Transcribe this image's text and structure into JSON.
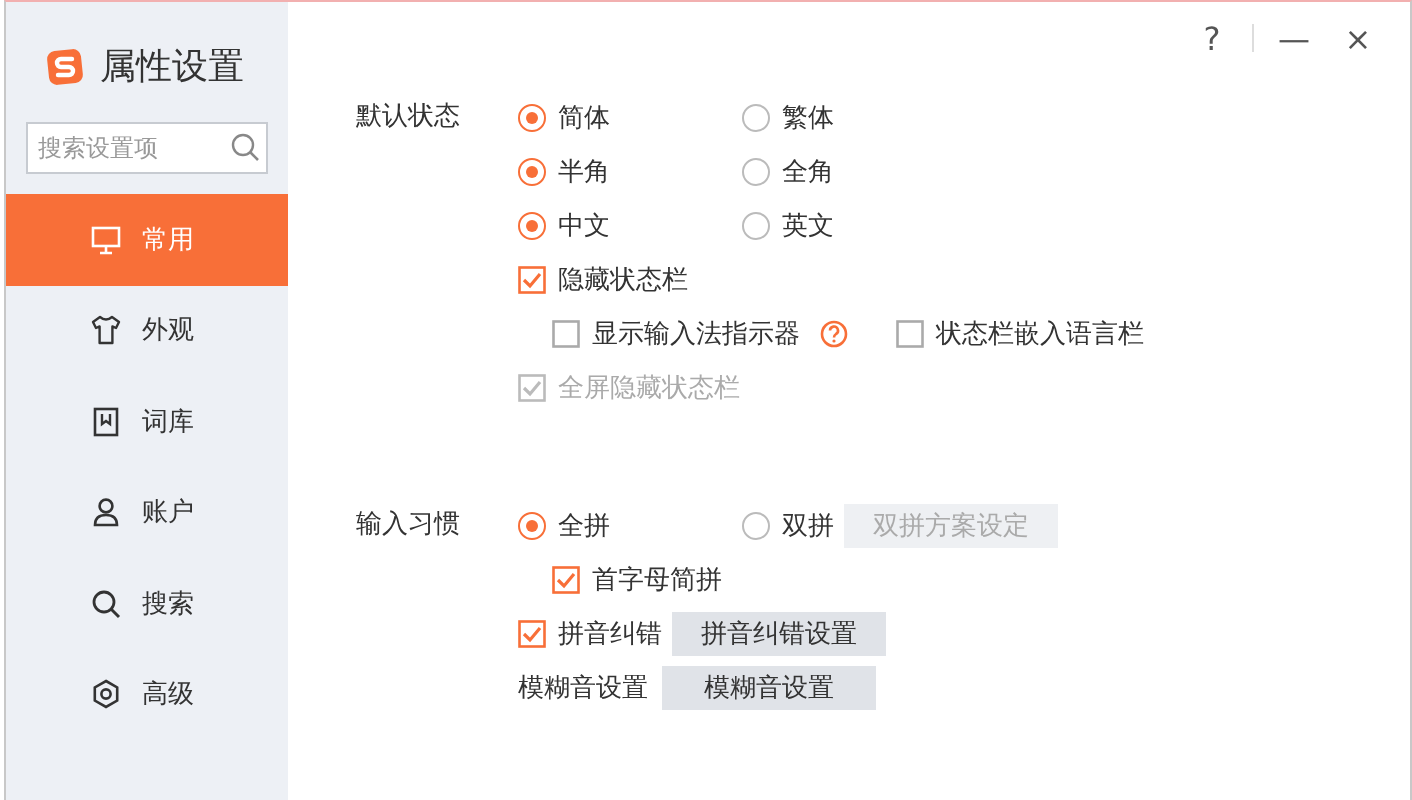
{
  "window": {
    "controls": [
      {
        "kind": "help",
        "label": "?"
      },
      {
        "kind": "minimize",
        "label": "—"
      },
      {
        "kind": "close",
        "label": "×"
      }
    ]
  },
  "sidebar": {
    "title": "属性设置",
    "search": {
      "placeholder": "搜索设置项"
    },
    "items": [
      {
        "label": "常用",
        "selected": true
      },
      {
        "label": "外观",
        "selected": false
      },
      {
        "label": "词库",
        "selected": false
      },
      {
        "label": "账户",
        "selected": false
      },
      {
        "label": "搜索",
        "selected": false
      },
      {
        "label": "高级",
        "selected": false
      }
    ]
  },
  "sections": [
    {
      "label": "默认状态",
      "rows": [
        {
          "kind": "radios",
          "options": [
            {
              "label": "简体",
              "selected": true
            },
            {
              "label": "繁体",
              "selected": false
            }
          ]
        },
        {
          "kind": "radios",
          "options": [
            {
              "label": "半角",
              "selected": true
            },
            {
              "label": "全角",
              "selected": false
            }
          ]
        },
        {
          "kind": "radios",
          "options": [
            {
              "label": "中文",
              "selected": true
            },
            {
              "label": "英文",
              "selected": false
            }
          ]
        },
        {
          "kind": "checkbox",
          "label": "隐藏状态栏",
          "checked": true,
          "disabled": false,
          "children": [
            {
              "kind": "inline",
              "items": [
                {
                  "label": "显示输入法指示器",
                  "checked": false,
                  "help": true
                },
                {
                  "label": "状态栏嵌入语言栏",
                  "checked": false,
                  "help": false
                }
              ]
            }
          ]
        },
        {
          "kind": "checkbox",
          "label": "全屏隐藏状态栏",
          "checked": true,
          "disabled": true
        }
      ]
    },
    {
      "label": "输入习惯",
      "rows": [
        {
          "kind": "radios",
          "options": [
            {
              "label": "全拼",
              "selected": true
            },
            {
              "label": "双拼",
              "selected": false,
              "button": {
                "label": "双拼方案设定",
                "disabled": true
              }
            }
          ],
          "children": [
            {
              "kind": "checkbox",
              "label": "首字母简拼",
              "checked": true,
              "disabled": false
            }
          ]
        },
        {
          "kind": "checkbox",
          "label": "拼音纠错",
          "checked": true,
          "disabled": false,
          "button": {
            "label": "拼音纠错设置",
            "disabled": false
          }
        },
        {
          "kind": "label",
          "label": "模糊音设置",
          "button": {
            "label": "模糊音设置",
            "disabled": false
          }
        }
      ]
    }
  ]
}
